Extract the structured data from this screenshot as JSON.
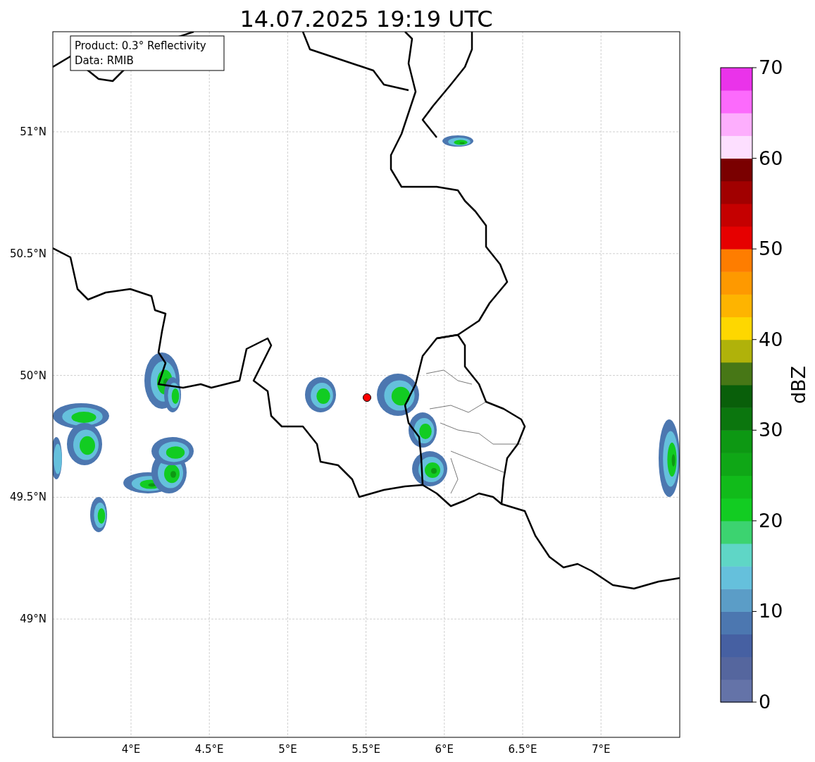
{
  "title": "14.07.2025 19:19 UTC",
  "annotation": [
    "Product: 0.3° Reflectivity",
    "Data: RMIB"
  ],
  "map": {
    "xticks": [
      "4°E",
      "4.5°E",
      "5°E",
      "5.5°E",
      "6°E",
      "6.5°E",
      "7°E"
    ],
    "yticks": [
      "51°N",
      "50.5°N",
      "50°N",
      "49.5°N",
      "49°N"
    ]
  },
  "colorbar": {
    "label": "dBZ",
    "ticks": [
      "70",
      "60",
      "50",
      "40",
      "30",
      "20",
      "10",
      "0"
    ],
    "bins": [
      {
        "color": "#6473a8"
      },
      {
        "color": "#55669e"
      },
      {
        "color": "#4660a2"
      },
      {
        "color": "#4c77b0"
      },
      {
        "color": "#5b9dc7"
      },
      {
        "color": "#65c0dc"
      },
      {
        "color": "#5fd6c6"
      },
      {
        "color": "#3cd370"
      },
      {
        "color": "#12cc22"
      },
      {
        "color": "#11bb1a"
      },
      {
        "color": "#0fa716"
      },
      {
        "color": "#0d9813"
      },
      {
        "color": "#0b760e"
      },
      {
        "color": "#095f0a"
      },
      {
        "color": "#477716"
      },
      {
        "color": "#b0b20a"
      },
      {
        "color": "#fed700"
      },
      {
        "color": "#feb400"
      },
      {
        "color": "#fe9900"
      },
      {
        "color": "#fe7d00"
      },
      {
        "color": "#e60000"
      },
      {
        "color": "#c50000"
      },
      {
        "color": "#a10000"
      },
      {
        "color": "#7a0000"
      },
      {
        "color": "#fddfff"
      },
      {
        "color": "#fdaefd"
      },
      {
        "color": "#fc6afc"
      },
      {
        "color": "#ea33ea"
      }
    ]
  }
}
